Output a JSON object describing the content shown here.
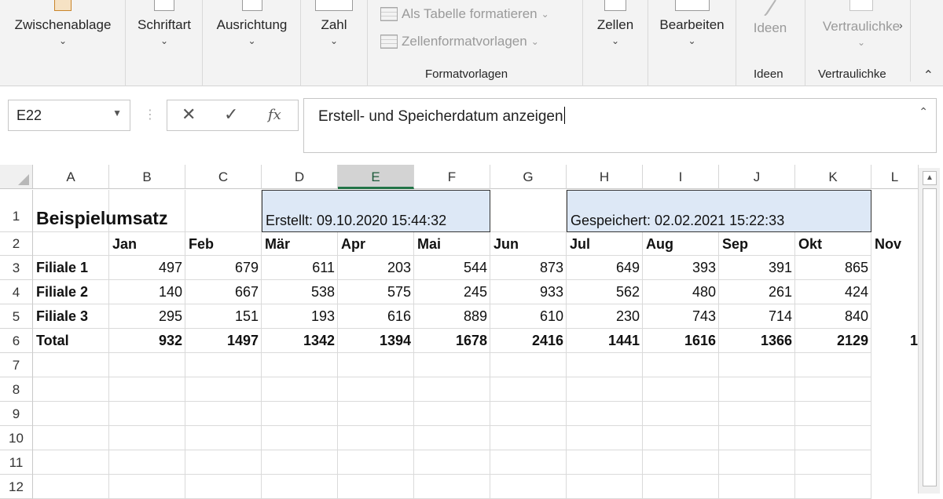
{
  "ribbon": {
    "zwischenablage": "Zwischenablage",
    "schriftart": "Schriftart",
    "ausrichtung": "Ausrichtung",
    "zahl": "Zahl",
    "als_tabelle": "Als Tabelle formatieren",
    "zellenformatvorlagen": "Zellenformatvorlagen",
    "formatvorlagen_group": "Formatvorlagen",
    "zellen": "Zellen",
    "bearbeiten": "Bearbeiten",
    "ideen_btn": "Ideen",
    "ideen_group": "Ideen",
    "vertraulichkeit_btn": "Vertraulichke",
    "vertraulichkeit_group": "Vertraulichke"
  },
  "formula_bar": {
    "name_box": "E22",
    "cancel_icon": "x-icon",
    "enter_icon": "check-icon",
    "function_icon": "fx",
    "content": "Erstell- und Speicherdatum anzeigen"
  },
  "columns": [
    "A",
    "B",
    "C",
    "D",
    "E",
    "F",
    "G",
    "H",
    "I",
    "J",
    "K",
    "L"
  ],
  "selected_column": "E",
  "rows": [
    "1",
    "2",
    "3",
    "4",
    "5",
    "6",
    "7",
    "8",
    "9",
    "10",
    "11",
    "12"
  ],
  "sheet": {
    "title": "Beispielumsatz",
    "created": "Erstellt: 09.10.2020 15:44:32",
    "saved": "Gespeichert: 02.02.2021 15:22:33",
    "months": [
      "Jan",
      "Feb",
      "Mär",
      "Apr",
      "Mai",
      "Jun",
      "Jul",
      "Aug",
      "Sep",
      "Okt",
      "Nov"
    ],
    "data_rows": [
      {
        "label": "Filiale 1",
        "values": [
          "497",
          "679",
          "611",
          "203",
          "544",
          "873",
          "649",
          "393",
          "391",
          "865"
        ]
      },
      {
        "label": "Filiale 2",
        "values": [
          "140",
          "667",
          "538",
          "575",
          "245",
          "933",
          "562",
          "480",
          "261",
          "424"
        ]
      },
      {
        "label": "Filiale 3",
        "values": [
          "295",
          "151",
          "193",
          "616",
          "889",
          "610",
          "230",
          "743",
          "714",
          "840"
        ]
      }
    ],
    "total": {
      "label": "Total",
      "values": [
        "932",
        "1497",
        "1342",
        "1394",
        "1678",
        "2416",
        "1441",
        "1616",
        "1366",
        "2129"
      ],
      "clipped": "1"
    }
  }
}
